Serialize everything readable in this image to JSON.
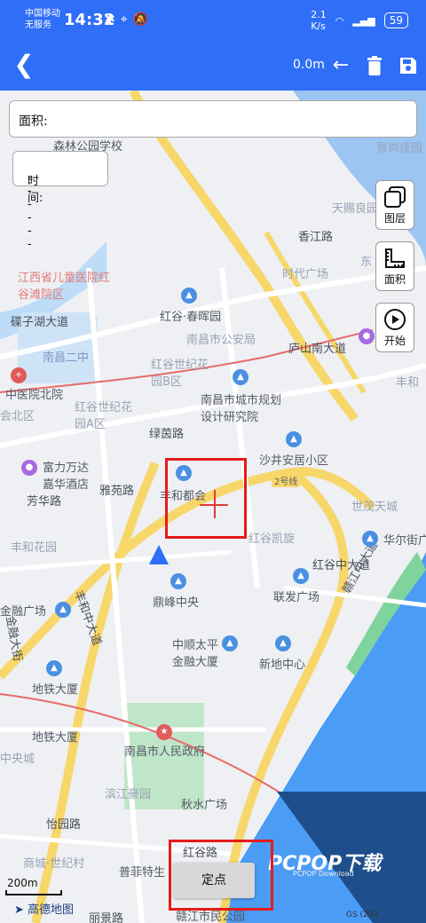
{
  "status_bar": {
    "carrier_line1": "中国移动",
    "carrier_line2": "无服务",
    "time": "14:32",
    "net_speed_value": "2.1",
    "net_speed_unit": "K/s",
    "battery": "59"
  },
  "toolbar": {
    "distance": "0.0m",
    "back_icon": "chevron-left-icon",
    "undo_icon": "arrow-left-icon",
    "delete_icon": "trash-icon",
    "save_icon": "save-icon"
  },
  "area": {
    "label": "面积:"
  },
  "time_display": {
    "label": "时间:",
    "value": "-- -- --"
  },
  "side_buttons": [
    {
      "label": "图层",
      "icon": "layers-icon"
    },
    {
      "label": "面积",
      "icon": "ruler-icon"
    },
    {
      "label": "开始",
      "icon": "play-icon"
    }
  ],
  "map": {
    "labels": {
      "school": "森林公园学校",
      "hospital": "江西省儿童医院红谷滩院区",
      "road_diezihu": "碟子湖大道",
      "nanchang2": "南昌二中",
      "hospital_north": "中医院北院",
      "hui_north": "会北区",
      "honggu_chun": "红谷·春晖园",
      "police": "南昌市公安局",
      "lushan": "庐山南大道",
      "honggu_b": "红谷世纪花园B区",
      "honggu_a": "红谷世纪花园A区",
      "road_lvyin": "绿茵路",
      "urban_planning": "南昌市城市规划设计研究院",
      "shajing": "沙井安居小区",
      "fuli": "富力万达嘉华酒店",
      "yiyuan": "芳华路",
      "road_yayuan": "雅苑路",
      "fenghe_dou": "丰和都会",
      "honggu_kai": "红谷凯旋",
      "shimao": "世茂天城",
      "huaer": "华尔街广场",
      "honggu_zhong": "红谷中大道",
      "lianfa": "联发广场",
      "dingfeng": "鼎峰中央",
      "zhongshun": "中顺太平金融大厦",
      "xindi": "新地中心",
      "fenghe_road": "丰和中大道",
      "ganjiang": "赣江中大道",
      "jinrong": "金融大街",
      "ditie_sha": "地铁大厦",
      "ditie_sha2": "地铁大厦",
      "zhongyang": "中央城",
      "gov": "南昌市人民政府",
      "binjiang": "滨江豪园",
      "qiushui": "秋水广场",
      "yiyuan_road": "怡园路",
      "shangcheng": "商城·世纪村",
      "pufei": "普菲特生",
      "honggu_road": "红谷路",
      "ganjiang_park": "赣江市民公园",
      "lili": "丽景路",
      "fenghe_huayuan": "丰和花园",
      "jinrong_guangchang": "金融广场",
      "xiangjiang": "香江路",
      "shidai": "时代广场",
      "tianci": "天赐良园",
      "jinggang": "景岗佳园",
      "dong": "东",
      "fenghe_short": "丰和",
      "road_2hao": "2号线"
    },
    "confirm_button": "定点",
    "scale": "200m",
    "logo": "高德地图",
    "copyright": "GS (202",
    "watermark": "PCPOP下载",
    "watermark_sub": "PCPOP Download"
  }
}
